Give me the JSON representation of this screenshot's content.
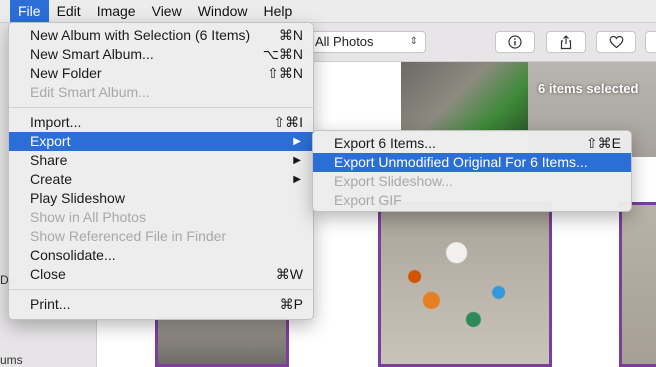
{
  "menubar": {
    "items": [
      "File",
      "Edit",
      "Image",
      "View",
      "Window",
      "Help"
    ]
  },
  "toolbar": {
    "filter_value": "All Photos",
    "info_icon": "info-icon",
    "share_icon": "share-icon",
    "favorite_icon": "heart-icon"
  },
  "content": {
    "selection_label": "6 items selected"
  },
  "sidebar": {
    "fragment_1": "De",
    "fragment_2": "ums"
  },
  "file_menu": {
    "items": [
      {
        "label": "New Album with Selection (6 Items)",
        "shortcut": "⌘N"
      },
      {
        "label": "New Smart Album...",
        "shortcut": "⌥⌘N"
      },
      {
        "label": "New Folder",
        "shortcut": "⇧⌘N"
      },
      {
        "label": "Edit Smart Album..."
      },
      {
        "label": "Import...",
        "shortcut": "⇧⌘I"
      },
      {
        "label": "Export"
      },
      {
        "label": "Share"
      },
      {
        "label": "Create"
      },
      {
        "label": "Play Slideshow"
      },
      {
        "label": "Show in All Photos"
      },
      {
        "label": "Show Referenced File in Finder"
      },
      {
        "label": "Consolidate..."
      },
      {
        "label": "Close",
        "shortcut": "⌘W"
      },
      {
        "label": "Print...",
        "shortcut": "⌘P"
      }
    ]
  },
  "export_menu": {
    "items": [
      {
        "label": "Export 6 Items...",
        "shortcut": "⇧⌘E"
      },
      {
        "label": "Export Unmodified Original For 6 Items..."
      },
      {
        "label": "Export Slideshow..."
      },
      {
        "label": "Export GIF"
      }
    ]
  },
  "colors": {
    "accent": "#2b6fd6",
    "selection_border": "#7b3e9a"
  }
}
